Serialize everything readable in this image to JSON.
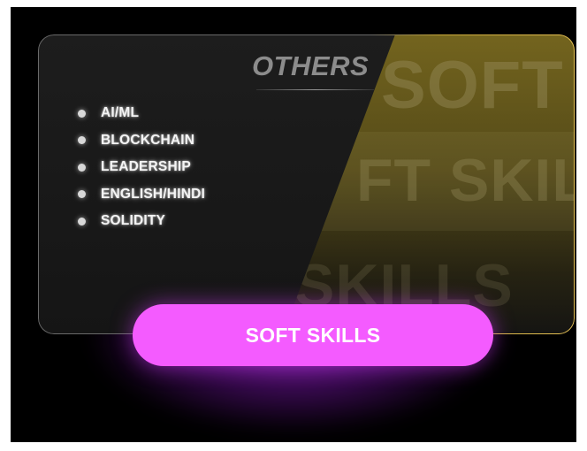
{
  "card": {
    "title": "OTHERS",
    "items": [
      {
        "label": "AI/ML"
      },
      {
        "label": "BLOCKCHAIN"
      },
      {
        "label": "LEADERSHIP"
      },
      {
        "label": "ENGLISH/HINDI"
      },
      {
        "label": "SOLIDITY"
      }
    ],
    "background_words": [
      "SOFT",
      "FT SKILLS",
      "SKILLS"
    ]
  },
  "button": {
    "label": "SOFT SKILLS"
  },
  "colors": {
    "background": "#000000",
    "card": "#1a1a1a",
    "accent_gold": "#e7c255",
    "button": "#f45bff",
    "glow": "#a828dc",
    "text": "#f4f4f4",
    "title": "#8c8c8c"
  }
}
